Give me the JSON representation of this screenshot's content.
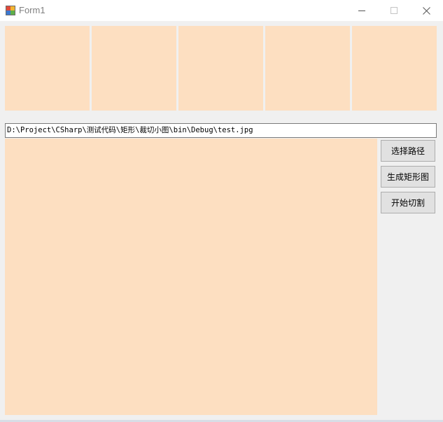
{
  "window": {
    "title": "Form1",
    "icon": "winforms-app-icon",
    "controls": {
      "minimize_icon": "minimize-icon",
      "maximize_icon": "maximize-icon",
      "close_icon": "close-icon"
    }
  },
  "thumbnails": {
    "count": 5,
    "color": "#fddfc1"
  },
  "path_input": {
    "value": "D:\\Project\\CSharp\\测试代码\\矩形\\裁切小图\\bin\\Debug\\test.jpg"
  },
  "image_panel": {
    "color": "#fddfc1"
  },
  "buttons": {
    "select_path": "选择路径",
    "generate_rect": "生成矩形图",
    "start_cut": "开始切割"
  }
}
